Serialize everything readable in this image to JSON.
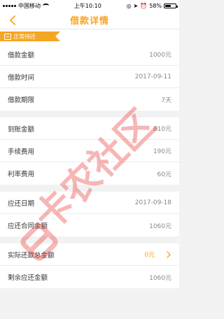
{
  "status_bar": {
    "carrier": "中国移动",
    "time": "上午10:10",
    "battery": "58%",
    "battery_level": 0.58
  },
  "nav": {
    "title": "借款详情"
  },
  "banner": {
    "label": "正常待还"
  },
  "groups": [
    {
      "rows": [
        {
          "label": "借款金额",
          "value": "1000元"
        },
        {
          "label": "借款时间",
          "value": "2017-09-11"
        },
        {
          "label": "借款期限",
          "value": "7天"
        }
      ]
    },
    {
      "rows": [
        {
          "label": "到账金额",
          "value": "810元"
        },
        {
          "label": "手续费用",
          "value": "190元"
        },
        {
          "label": "利率费用",
          "value": "60元"
        }
      ]
    },
    {
      "rows": [
        {
          "label": "应还日期",
          "value": "2017-09-18"
        },
        {
          "label": "应还合同金额",
          "value": "1060元"
        }
      ]
    },
    {
      "rows": [
        {
          "label": "实际还款总金额",
          "value": "0元"
        },
        {
          "label": "剩余应还金额",
          "value": "1060元"
        }
      ]
    }
  ],
  "watermark": {
    "text": "卡农社区"
  },
  "colors": {
    "accent": "#f5a623",
    "watermark": "#e8322d"
  }
}
